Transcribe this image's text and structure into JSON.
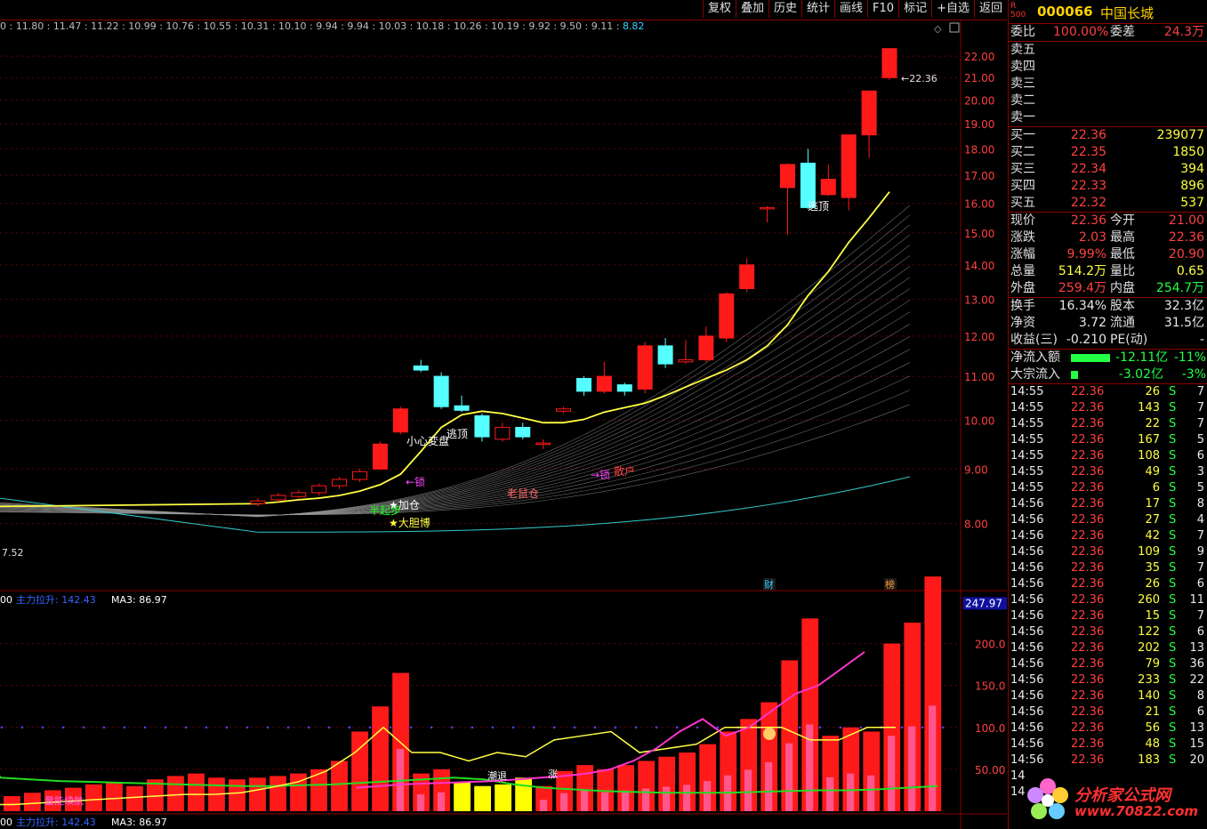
{
  "toolbar": {
    "buttons": [
      "复权",
      "叠加",
      "历史",
      "统计",
      "画线",
      "F10",
      "标记",
      "+自选",
      "返回"
    ]
  },
  "price_strip": {
    "text": "0 : 11.80 : 11.47 : 11.22 : 10.99 : 10.76 : 10.55 : 10.31 : 10.10 : 9.94 : 9.94 : 10.03 : 10.18 : 10.26 : 10.19 : 9.92 : 9.50 : 9.11 : ",
    "last": "8.82"
  },
  "main_chart": {
    "price_axis": [
      "22.00",
      "21.00",
      "20.00",
      "19.00",
      "18.00",
      "17.00",
      "16.00",
      "15.00",
      "14.00",
      "13.00",
      "12.00",
      "11.00",
      "10.00",
      "9.00",
      "8.00"
    ],
    "high_label": "22.36",
    "low_label": "7.52",
    "annotations": [
      "逃顶",
      "小心変盘",
      "逃顶",
      "←锁",
      "加仓",
      "大胆博",
      "半起步",
      "老鼠仓",
      "锁",
      "散户"
    ],
    "markers": [
      "财",
      "榜"
    ],
    "indicator_title": "主力拉升: 142.43",
    "indicator_ma": "MA3: 86.97",
    "indicator_title2": "主力拉升: 142.43",
    "indicator_ma2": "MA3: 86.97",
    "indicator_left0": "00",
    "indicator_left1": "00",
    "indicator_axis": [
      "200.0",
      "150.0",
      "100.0",
      "50.00"
    ],
    "indicator_current": "247.97",
    "indicator_labels": [
      "量能续航",
      "潮退",
      "涨"
    ],
    "colors": {
      "up": "#ff1a1a",
      "down": "#55ffff",
      "ma_yellow": "#ffff44",
      "magenta": "#ff33cc",
      "green": "#22cc22"
    }
  },
  "chart_data": {
    "type": "candlestick",
    "candles": [
      {
        "o": 8.35,
        "h": 8.45,
        "l": 8.3,
        "c": 8.4
      },
      {
        "o": 8.42,
        "h": 8.55,
        "l": 8.38,
        "c": 8.5
      },
      {
        "o": 8.48,
        "h": 8.6,
        "l": 8.45,
        "c": 8.55
      },
      {
        "o": 8.55,
        "h": 8.72,
        "l": 8.5,
        "c": 8.68
      },
      {
        "o": 8.68,
        "h": 8.85,
        "l": 8.62,
        "c": 8.8
      },
      {
        "o": 8.8,
        "h": 9.0,
        "l": 8.75,
        "c": 8.95
      },
      {
        "o": 9.0,
        "h": 9.55,
        "l": 8.98,
        "c": 9.5
      },
      {
        "o": 9.75,
        "h": 10.3,
        "l": 9.7,
        "c": 10.25
      },
      {
        "o": 11.25,
        "h": 11.4,
        "l": 11.1,
        "c": 11.15
      },
      {
        "o": 11.0,
        "h": 11.1,
        "l": 10.25,
        "c": 10.3
      },
      {
        "o": 10.32,
        "h": 10.55,
        "l": 10.18,
        "c": 10.22
      },
      {
        "o": 10.1,
        "h": 10.15,
        "l": 9.55,
        "c": 9.65
      },
      {
        "o": 9.6,
        "h": 9.95,
        "l": 9.55,
        "c": 9.85
      },
      {
        "o": 9.85,
        "h": 9.95,
        "l": 9.6,
        "c": 9.65
      },
      {
        "o": 9.5,
        "h": 9.6,
        "l": 9.4,
        "c": 9.52
      },
      {
        "o": 10.2,
        "h": 10.3,
        "l": 10.15,
        "c": 10.25
      },
      {
        "o": 10.95,
        "h": 11.0,
        "l": 10.55,
        "c": 10.65
      },
      {
        "o": 10.65,
        "h": 11.35,
        "l": 10.6,
        "c": 11.0
      },
      {
        "o": 10.8,
        "h": 10.85,
        "l": 10.55,
        "c": 10.65
      },
      {
        "o": 10.7,
        "h": 11.85,
        "l": 10.6,
        "c": 11.75
      },
      {
        "o": 11.75,
        "h": 11.95,
        "l": 11.2,
        "c": 11.3
      },
      {
        "o": 11.35,
        "h": 11.9,
        "l": 11.3,
        "c": 11.4
      },
      {
        "o": 11.4,
        "h": 12.25,
        "l": 11.35,
        "c": 12.0
      },
      {
        "o": 11.95,
        "h": 13.2,
        "l": 11.85,
        "c": 13.15
      },
      {
        "o": 13.3,
        "h": 14.2,
        "l": 13.2,
        "c": 14.0
      },
      {
        "o": 15.85,
        "h": 15.9,
        "l": 15.35,
        "c": 15.85
      },
      {
        "o": 16.55,
        "h": 17.45,
        "l": 14.95,
        "c": 17.4
      },
      {
        "o": 17.45,
        "h": 18.0,
        "l": 15.8,
        "c": 15.85
      },
      {
        "o": 16.3,
        "h": 17.4,
        "l": 16.25,
        "c": 16.85
      },
      {
        "o": 16.2,
        "h": 18.55,
        "l": 15.75,
        "c": 18.55
      },
      {
        "o": 18.55,
        "h": 20.4,
        "l": 17.65,
        "c": 20.4
      },
      {
        "o": 21.0,
        "h": 22.36,
        "l": 20.9,
        "c": 22.36
      }
    ],
    "ylim": [
      7.5,
      23.0
    ],
    "indicator": {
      "bars": [
        18,
        22,
        25,
        28,
        32,
        35,
        30,
        38,
        42,
        45,
        40,
        38,
        40,
        42,
        45,
        50,
        60,
        95,
        125,
        165,
        45,
        50,
        35,
        30,
        32,
        40,
        30,
        48,
        55,
        50,
        55,
        60,
        65,
        70,
        80,
        95,
        110,
        130,
        180,
        230,
        90,
        100,
        95,
        200,
        225,
        280
      ],
      "ylim": [
        0,
        260
      ]
    }
  },
  "quote": {
    "r_label": "R\n500",
    "code": "000066",
    "name": "中国长城",
    "weibi_label": "委比",
    "weibi": "100.00%",
    "weicha_label": "委差",
    "weicha": "24.3万",
    "sell_levels": [
      {
        "label": "卖五"
      },
      {
        "label": "卖四"
      },
      {
        "label": "卖三"
      },
      {
        "label": "卖二"
      },
      {
        "label": "卖一"
      }
    ],
    "buy_levels": [
      {
        "label": "买一",
        "price": "22.36",
        "vol": "239077"
      },
      {
        "label": "买二",
        "price": "22.35",
        "vol": "1850"
      },
      {
        "label": "买三",
        "price": "22.34",
        "vol": "394"
      },
      {
        "label": "买四",
        "price": "22.33",
        "vol": "896"
      },
      {
        "label": "买五",
        "price": "22.32",
        "vol": "537"
      }
    ],
    "stats": [
      {
        "l1": "现价",
        "v1": "22.36",
        "l2": "今开",
        "v2": "21.00"
      },
      {
        "l1": "涨跌",
        "v1": "2.03",
        "l2": "最高",
        "v2": "22.36"
      },
      {
        "l1": "涨幅",
        "v1": "9.99%",
        "l2": "最低",
        "v2": "20.90"
      },
      {
        "l1": "总量",
        "v1": "514.2万",
        "l2": "量比",
        "v2": "0.65"
      },
      {
        "l1": "外盘",
        "v1": "259.4万",
        "l2": "内盘",
        "v2": "254.7万"
      }
    ],
    "stats2": [
      {
        "l1": "换手",
        "v1": "16.34%",
        "l2": "股本",
        "v2": "32.3亿"
      },
      {
        "l1": "净资",
        "v1": "3.72",
        "l2": "流通",
        "v2": "31.5亿"
      },
      {
        "l1": "收益(三)",
        "v1": "-0.210",
        "l2": "PE(动)",
        "v2": "-"
      }
    ],
    "flows": [
      {
        "label": "净流入额",
        "amount": "-12.11亿",
        "pct": "-11%"
      },
      {
        "label": "大宗流入",
        "amount": "-3.02亿",
        "pct": "-3%"
      }
    ],
    "ticks": [
      {
        "t": "14:55",
        "p": "22.36",
        "v": "26",
        "s": "S",
        "n": "7"
      },
      {
        "t": "14:55",
        "p": "22.36",
        "v": "143",
        "s": "S",
        "n": "7"
      },
      {
        "t": "14:55",
        "p": "22.36",
        "v": "22",
        "s": "S",
        "n": "7"
      },
      {
        "t": "14:55",
        "p": "22.36",
        "v": "167",
        "s": "S",
        "n": "5"
      },
      {
        "t": "14:55",
        "p": "22.36",
        "v": "108",
        "s": "S",
        "n": "6"
      },
      {
        "t": "14:55",
        "p": "22.36",
        "v": "49",
        "s": "S",
        "n": "3"
      },
      {
        "t": "14:55",
        "p": "22.36",
        "v": "6",
        "s": "S",
        "n": "5"
      },
      {
        "t": "14:56",
        "p": "22.36",
        "v": "17",
        "s": "S",
        "n": "8"
      },
      {
        "t": "14:56",
        "p": "22.36",
        "v": "27",
        "s": "S",
        "n": "4"
      },
      {
        "t": "14:56",
        "p": "22.36",
        "v": "42",
        "s": "S",
        "n": "7"
      },
      {
        "t": "14:56",
        "p": "22.36",
        "v": "109",
        "s": "S",
        "n": "9"
      },
      {
        "t": "14:56",
        "p": "22.36",
        "v": "35",
        "s": "S",
        "n": "7"
      },
      {
        "t": "14:56",
        "p": "22.36",
        "v": "26",
        "s": "S",
        "n": "6"
      },
      {
        "t": "14:56",
        "p": "22.36",
        "v": "260",
        "s": "S",
        "n": "11"
      },
      {
        "t": "14:56",
        "p": "22.36",
        "v": "15",
        "s": "S",
        "n": "7"
      },
      {
        "t": "14:56",
        "p": "22.36",
        "v": "122",
        "s": "S",
        "n": "6"
      },
      {
        "t": "14:56",
        "p": "22.36",
        "v": "202",
        "s": "S",
        "n": "13"
      },
      {
        "t": "14:56",
        "p": "22.36",
        "v": "79",
        "s": "S",
        "n": "36"
      },
      {
        "t": "14:56",
        "p": "22.36",
        "v": "233",
        "s": "S",
        "n": "22"
      },
      {
        "t": "14:56",
        "p": "22.36",
        "v": "140",
        "s": "S",
        "n": "8"
      },
      {
        "t": "14:56",
        "p": "22.36",
        "v": "21",
        "s": "S",
        "n": "6"
      },
      {
        "t": "14:56",
        "p": "22.36",
        "v": "56",
        "s": "S",
        "n": "13"
      },
      {
        "t": "14:56",
        "p": "22.36",
        "v": "48",
        "s": "S",
        "n": "15"
      },
      {
        "t": "14:56",
        "p": "22.36",
        "v": "183",
        "s": "S",
        "n": "20"
      },
      {
        "t": "14",
        "p": "",
        "v": "",
        "s": "",
        "n": ""
      },
      {
        "t": "14",
        "p": "",
        "v": "",
        "s": "",
        "n": ""
      }
    ]
  },
  "watermark": {
    "text": "分析家公式网",
    "url": "www.70822.com"
  }
}
